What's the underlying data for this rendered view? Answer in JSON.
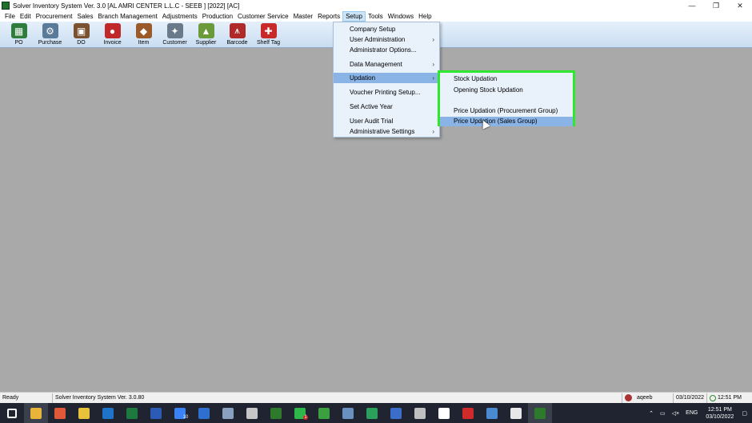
{
  "window": {
    "title": "Solver Inventory System Ver. 3.0 [AL AMRI CENTER L.L.C - SEEB ] [2022]  [AC]",
    "minimize_glyph": "—",
    "maximize_glyph": "❐",
    "close_glyph": "✕"
  },
  "menubar": {
    "items": [
      "File",
      "Edit",
      "Procurement",
      "Sales",
      "Branch Management",
      "Adjustments",
      "Production",
      "Customer Service",
      "Master",
      "Reports",
      "Setup",
      "Tools",
      "Windows",
      "Help"
    ],
    "active": "Setup"
  },
  "toolbar": {
    "items": [
      {
        "label": "PO",
        "icon": "po-icon",
        "color": "#2f7d3c"
      },
      {
        "label": "Purchase",
        "icon": "purchase-icon",
        "color": "#5a7a9a"
      },
      {
        "label": "DO",
        "icon": "do-icon",
        "color": "#7a5230"
      },
      {
        "label": "Invoice",
        "icon": "invoice-icon",
        "color": "#c0282a"
      },
      {
        "label": "Item",
        "icon": "item-icon",
        "color": "#9a5a2a"
      },
      {
        "label": "Customer",
        "icon": "customer-icon",
        "color": "#6a7a8a"
      },
      {
        "label": "Supplier",
        "icon": "supplier-icon",
        "color": "#6a9a3a"
      },
      {
        "label": "Barcode",
        "icon": "barcode-icon",
        "color": "#b02a2a"
      },
      {
        "label": "Shelf Tag",
        "icon": "shelf-tag-icon",
        "color": "#c82a2a"
      }
    ]
  },
  "setup_menu": {
    "items": [
      {
        "label": "Company Setup",
        "submenu": false
      },
      {
        "label": "User Administration",
        "submenu": true
      },
      {
        "label": "Administrator Options...",
        "submenu": false
      },
      {
        "label": "Data Management",
        "submenu": true
      },
      {
        "label": "Updation",
        "submenu": true,
        "highlighted": true
      },
      {
        "label": "Voucher Printing Setup...",
        "submenu": false
      },
      {
        "label": "Set Active Year",
        "submenu": false
      },
      {
        "label": "User Audit Trial",
        "submenu": false
      },
      {
        "label": "Administrative Settings",
        "submenu": true
      }
    ]
  },
  "updation_submenu": {
    "items": [
      {
        "label": "Stock Updation"
      },
      {
        "label": "Opening Stock Updation"
      },
      {
        "label": "Price Updation (Procurement Group)"
      },
      {
        "label": "Price Updation (Sales Group)",
        "highlighted": true
      }
    ],
    "highlight_border": "#2ee82e"
  },
  "statusbar": {
    "state": "Ready",
    "version": "Solver Inventory System Ver. 3.0.80",
    "user": "aqeeb",
    "date": "03/10/2022",
    "time": "12:51 PM"
  },
  "taskbar": {
    "icons": [
      "windows-start-icon",
      "file-explorer-icon",
      "app-icon",
      "chrome-icon",
      "outlook-icon",
      "excel-icon",
      "word-icon",
      "todo-icon",
      "app-icon",
      "app-icon",
      "calculator-icon",
      "solver-icon",
      "whatsapp-icon",
      "app-icon",
      "app-icon",
      "app-icon",
      "app-icon",
      "app-icon",
      "app-icon",
      "acrobat-icon",
      "app-icon",
      "app-icon",
      "solver-icon"
    ],
    "todo_badge": "10",
    "whatsapp_badge": "1",
    "language": "ENG",
    "clock_time": "12:51 PM",
    "clock_date": "03/10/2022"
  },
  "colors": {
    "desktop_bg": "#a9a9a9",
    "menu_bg": "#e9f1fb",
    "highlight": "#8ab4e6",
    "taskbar_bg": "#1f2430"
  }
}
